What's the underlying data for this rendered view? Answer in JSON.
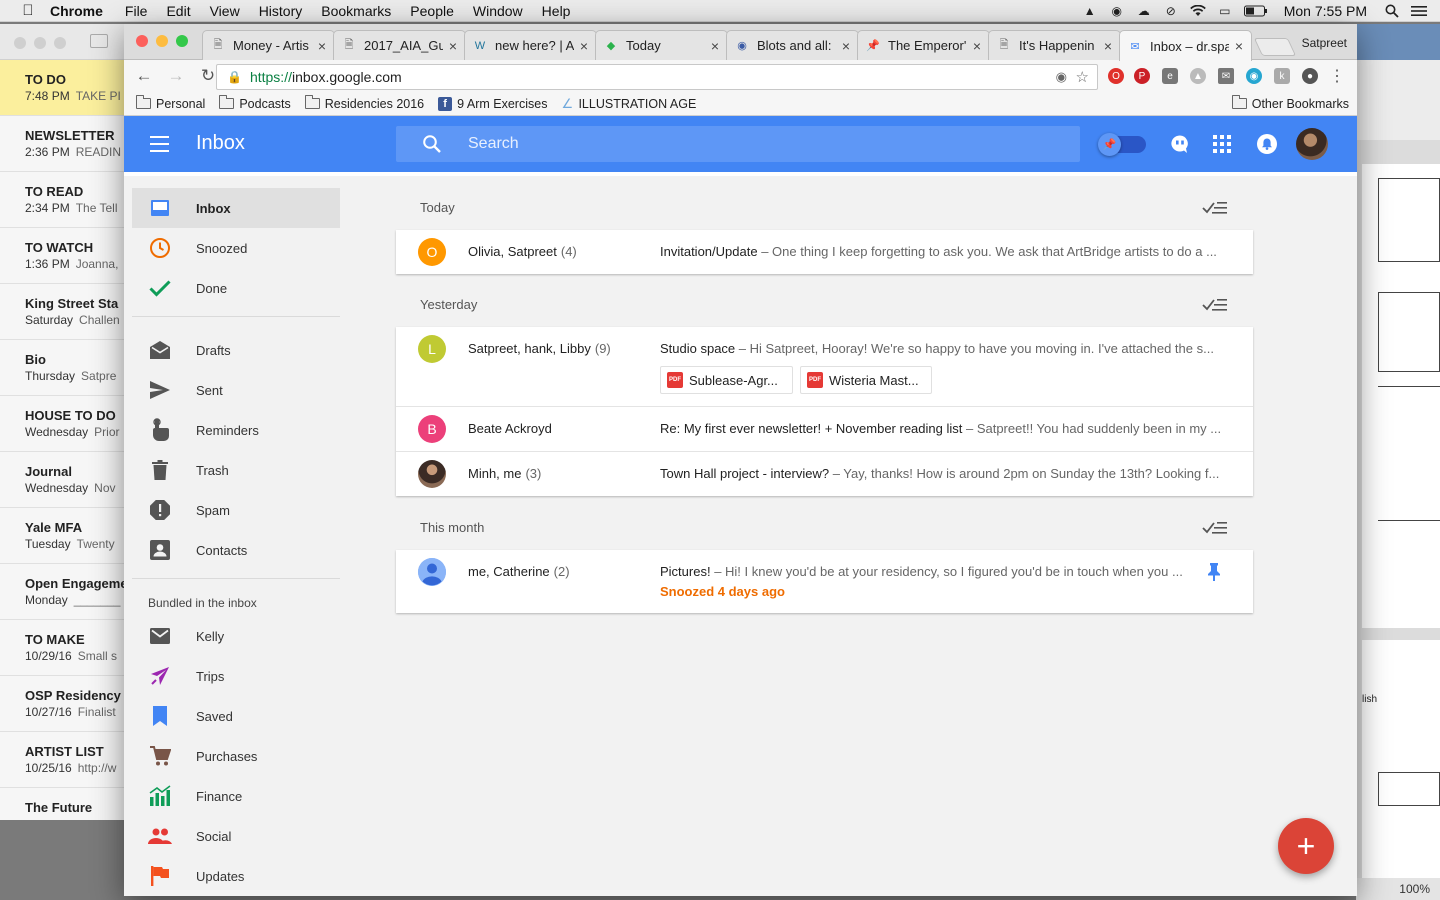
{
  "menubar": {
    "app": "Chrome",
    "items": [
      "File",
      "Edit",
      "View",
      "History",
      "Bookmarks",
      "People",
      "Window",
      "Help"
    ],
    "clock": "Mon 7:55 PM"
  },
  "notes": [
    {
      "title": "TO DO",
      "time": "7:48 PM",
      "snippet": "TAKE PI"
    },
    {
      "title": "NEWSLETTER",
      "time": "2:36 PM",
      "snippet": "READIN"
    },
    {
      "title": "TO READ",
      "time": "2:34 PM",
      "snippet": "The Tell"
    },
    {
      "title": "TO WATCH",
      "time": "1:36 PM",
      "snippet": "Joanna,"
    },
    {
      "title": "King Street Sta",
      "time": "Saturday",
      "snippet": "Challen"
    },
    {
      "title": "Bio",
      "time": "Thursday",
      "snippet": "Satpre"
    },
    {
      "title": "HOUSE TO DO",
      "time": "Wednesday",
      "snippet": "Prior"
    },
    {
      "title": "Journal",
      "time": "Wednesday",
      "snippet": "Nov"
    },
    {
      "title": "Yale MFA",
      "time": "Tuesday",
      "snippet": "Twenty"
    },
    {
      "title": "Open Engageme",
      "time": "Monday",
      "snippet": "_______"
    },
    {
      "title": "TO MAKE",
      "time": "10/29/16",
      "snippet": "Small s"
    },
    {
      "title": "OSP Residency",
      "time": "10/27/16",
      "snippet": "Finalist"
    },
    {
      "title": "ARTIST LIST",
      "time": "10/25/16",
      "snippet": "http://w"
    },
    {
      "title": "The Future",
      "time": "",
      "snippet": ""
    }
  ],
  "rightdoc": {
    "zoom": "100%",
    "fragment": "lish"
  },
  "tabs": [
    {
      "title": "Money - Artis",
      "icon": "doc-icon"
    },
    {
      "title": "2017_AIA_Gu",
      "icon": "doc-icon"
    },
    {
      "title": "new here? | A",
      "icon": "wordpress-icon"
    },
    {
      "title": "Today",
      "icon": "feedly-icon"
    },
    {
      "title": "Blots and all:",
      "icon": "blog-icon"
    },
    {
      "title": "The Emperor'",
      "icon": "pin-icon"
    },
    {
      "title": "It's Happenin",
      "icon": "doc-icon"
    },
    {
      "title": "Inbox – dr.spa",
      "icon": "inbox-icon"
    }
  ],
  "profile_name": "Satpreet",
  "url": {
    "scheme": "https://",
    "host": "inbox.google.com"
  },
  "bookmarks": [
    "Personal",
    "Podcasts",
    "Residencies 2016",
    "9 Arm Exercises",
    "ILLUSTRATION AGE"
  ],
  "other_bookmarks": "Other Bookmarks",
  "app": {
    "title": "Inbox",
    "search_placeholder": "Search"
  },
  "nav": {
    "primary": [
      {
        "label": "Inbox",
        "icon": "inbox-tray-icon"
      },
      {
        "label": "Snoozed",
        "icon": "clock-icon"
      },
      {
        "label": "Done",
        "icon": "check-icon"
      }
    ],
    "secondary": [
      {
        "label": "Drafts",
        "icon": "drafts-icon"
      },
      {
        "label": "Sent",
        "icon": "send-icon"
      },
      {
        "label": "Reminders",
        "icon": "reminder-hand-icon"
      },
      {
        "label": "Trash",
        "icon": "trash-icon"
      },
      {
        "label": "Spam",
        "icon": "spam-icon"
      },
      {
        "label": "Contacts",
        "icon": "contacts-icon"
      }
    ],
    "bundled_label": "Bundled in the inbox",
    "bundles": [
      {
        "label": "Kelly",
        "icon": "mail-icon"
      },
      {
        "label": "Trips",
        "icon": "plane-icon"
      },
      {
        "label": "Saved",
        "icon": "bookmark-icon"
      },
      {
        "label": "Purchases",
        "icon": "cart-icon"
      },
      {
        "label": "Finance",
        "icon": "finance-icon"
      },
      {
        "label": "Social",
        "icon": "people-icon"
      },
      {
        "label": "Updates",
        "icon": "flag-icon"
      }
    ]
  },
  "sections": [
    {
      "label": "Today",
      "threads": [
        {
          "avatar": "O",
          "avatar_color": "#ff9800",
          "sender": "Olivia, Satpreet",
          "count": "(4)",
          "subject": "Invitation/Update",
          "snippet": " – One thing I keep forgetting to ask you. We ask that ArtBridge artists to do a ..."
        }
      ]
    },
    {
      "label": "Yesterday",
      "threads": [
        {
          "avatar": "L",
          "avatar_color": "#c0ca33",
          "sender": "Satpreet, hank, Libby",
          "count": "(9)",
          "subject": "Studio space",
          "snippet": " – Hi Satpreet, Hooray! We're so happy to have you moving in. I've attached the s...",
          "attachments": [
            "Sublease-Agr...",
            "Wisteria Mast..."
          ]
        },
        {
          "avatar": "B",
          "avatar_color": "#ec407a",
          "sender": "Beate Ackroyd",
          "count": "",
          "subject": "Re: My first ever newsletter! + November reading list",
          "snippet": " – Satpreet!! You had suddenly been in my ..."
        },
        {
          "avatar": "",
          "avatar_color": "#5d4037",
          "sender": "Minh, me",
          "count": "(3)",
          "subject": "Town Hall project - interview?",
          "snippet": " – Yay, thanks! How is around 2pm on Sunday the 13th? Looking f..."
        }
      ]
    },
    {
      "label": "This month",
      "threads": [
        {
          "avatar": "",
          "avatar_color": "#8ab4f8",
          "sender": "me, Catherine",
          "count": "(2)",
          "subject": "Pictures!",
          "snippet": " – Hi! I knew you'd be at your residency, so I figured you'd be in touch when you ...",
          "status": "Snoozed 4 days ago",
          "pinned": true
        }
      ]
    }
  ],
  "fab": "+",
  "colors": {
    "brand": "#4285f4",
    "fab": "#db4437",
    "snoozed": "#ef6c00"
  }
}
